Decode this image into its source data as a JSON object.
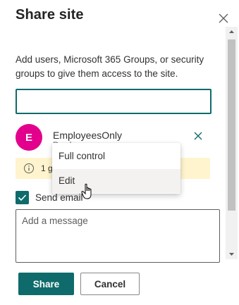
{
  "dialog": {
    "title": "Share site",
    "description": "Add users, Microsoft 365 Groups, or security groups to give them access to the site."
  },
  "search": {
    "value": "",
    "placeholder": ""
  },
  "user": {
    "initial": "E",
    "name": "EmployeesOnly",
    "permission": "Read",
    "avatar_color": "#e3008c"
  },
  "info_bar": {
    "text": "1 g",
    "color": "#fff4ce"
  },
  "send_email": {
    "label": "Send email",
    "checked": true
  },
  "message": {
    "placeholder": "Add a message",
    "value": ""
  },
  "dropdown": {
    "items": [
      {
        "label": "Full control",
        "hovered": false
      },
      {
        "label": "Edit",
        "hovered": true
      }
    ]
  },
  "buttons": {
    "share_label": "Share",
    "cancel_label": "Cancel"
  },
  "colors": {
    "primary": "#0f6b6b",
    "accent_avatar": "#e3008c",
    "info_bg": "#fff4ce"
  },
  "icons": [
    "close-icon",
    "remove-icon",
    "info-icon",
    "checkmark-icon",
    "chevron-up-icon",
    "chevron-down-icon",
    "hand-pointer-icon"
  ]
}
